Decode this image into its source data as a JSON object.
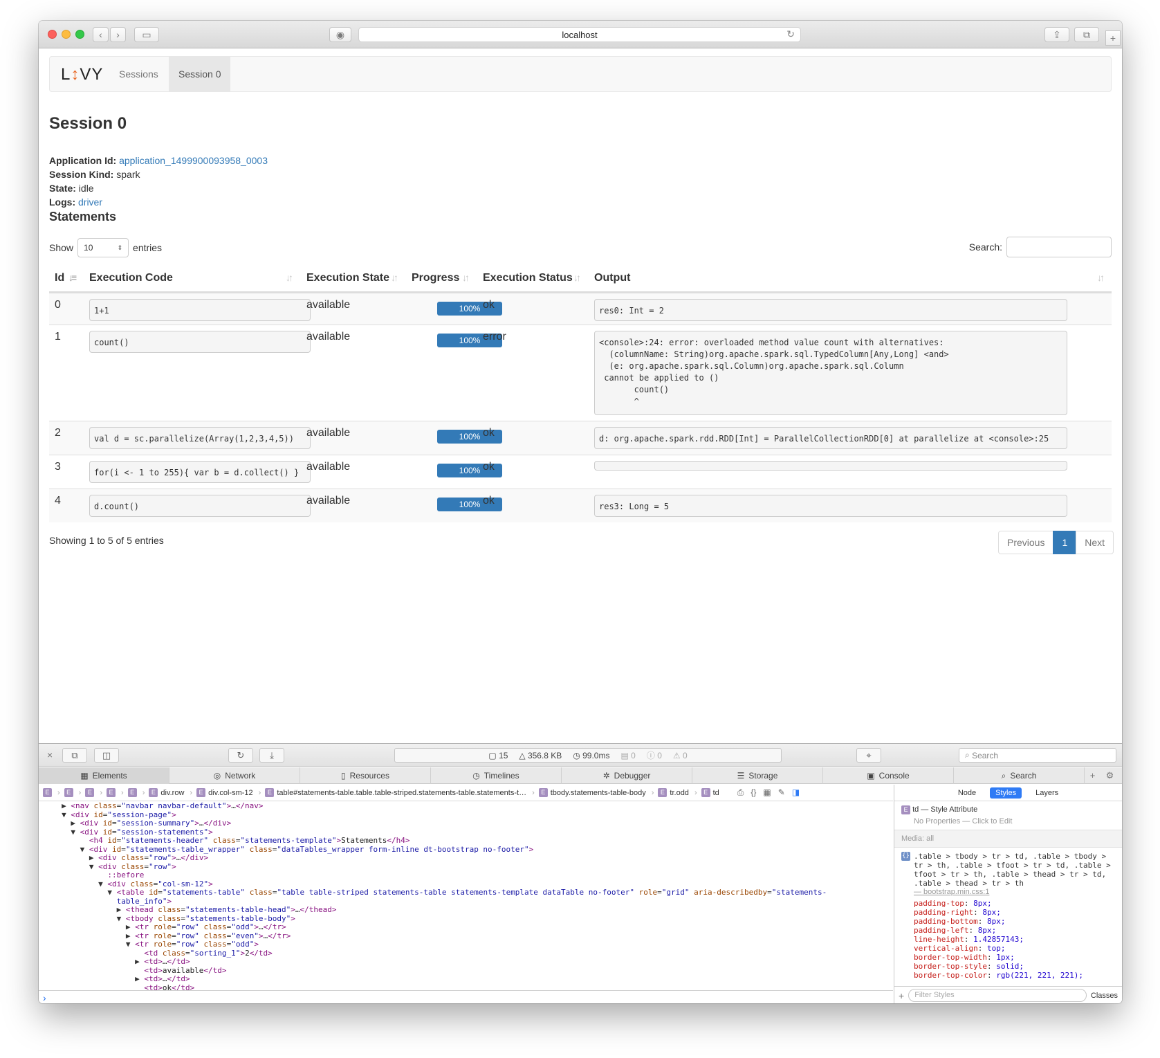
{
  "browser": {
    "url": "localhost"
  },
  "navbar": {
    "brand": "L↕VY",
    "items": [
      {
        "label": "Sessions"
      },
      {
        "label": "Session 0"
      }
    ]
  },
  "session": {
    "title": "Session 0",
    "app_id_label": "Application Id:",
    "app_id": "application_1499900093958_0003",
    "kind_label": "Session Kind:",
    "kind": "spark",
    "state_label": "State:",
    "state": "idle",
    "logs_label": "Logs:",
    "logs": "driver"
  },
  "statements": {
    "header": "Statements",
    "show_label": "Show",
    "page_length": "10",
    "entries_label": "entries",
    "search_label": "Search:",
    "columns": [
      "Id",
      "Execution Code",
      "Execution State",
      "Progress",
      "Execution Status",
      "Output"
    ],
    "rows": [
      {
        "id": "0",
        "code": "1+1",
        "state": "available",
        "progress": "100%",
        "status": "ok",
        "output": "res0: Int = 2"
      },
      {
        "id": "1",
        "code": "count()",
        "state": "available",
        "progress": "100%",
        "status": "error",
        "output": "<console>:24: error: overloaded method value count with alternatives:\n  (columnName: String)org.apache.spark.sql.TypedColumn[Any,Long] <and>\n  (e: org.apache.spark.sql.Column)org.apache.spark.sql.Column\n cannot be applied to ()\n       count()\n       ^"
      },
      {
        "id": "2",
        "code": "val d = sc.parallelize(Array(1,2,3,4,5))",
        "state": "available",
        "progress": "100%",
        "status": "ok",
        "output": "d: org.apache.spark.rdd.RDD[Int] = ParallelCollectionRDD[0] at parallelize at <console>:25"
      },
      {
        "id": "3",
        "code": "for(i <- 1 to 255){ var b = d.collect() }",
        "state": "available",
        "progress": "100%",
        "status": "ok",
        "output": ""
      },
      {
        "id": "4",
        "code": "d.count()",
        "state": "available",
        "progress": "100%",
        "status": "ok",
        "output": "res3: Long = 5"
      }
    ],
    "info": "Showing 1 to 5 of 5 entries",
    "pager": {
      "previous": "Previous",
      "current": "1",
      "next": "Next"
    }
  },
  "inspector": {
    "stats": {
      "resources": "15",
      "size": "356.8 KB",
      "time": "99.0ms",
      "logs": "0",
      "errors": "0",
      "warnings": "0"
    },
    "search_placeholder": "Search",
    "tabs": [
      "Elements",
      "Network",
      "Resources",
      "Timelines",
      "Debugger",
      "Storage",
      "Console",
      "Search"
    ],
    "breadcrumbs": [
      "div.row",
      "div.col-sm-12",
      "table#statements-table.table.table-striped.statements-table.statements-t…",
      "tbody.statements-table-body",
      "tr.odd",
      "td"
    ],
    "side_tabs": [
      "Node",
      "Styles",
      "Layers"
    ],
    "style_attr_title": "td — Style Attribute",
    "style_attr_note": "No Properties — Click to Edit",
    "media_label": "Media: all",
    "rule_selector": ".table > tbody > tr > td, .table > tbody > tr > th, .table > tfoot > tr > td, .table > tfoot > tr > th, .table > thead > tr > td, .table > thead > tr > th",
    "rule_source": "— bootstrap.min.css:1",
    "rule_props": [
      {
        "name": "padding-top",
        "value": "8px;"
      },
      {
        "name": "padding-right",
        "value": "8px;"
      },
      {
        "name": "padding-bottom",
        "value": "8px;"
      },
      {
        "name": "padding-left",
        "value": "8px;"
      },
      {
        "name": "line-height",
        "value": "1.42857143;"
      },
      {
        "name": "vertical-align",
        "value": "top;"
      },
      {
        "name": "border-top-width",
        "value": "1px;"
      },
      {
        "name": "border-top-style",
        "value": "solid;"
      },
      {
        "name": "border-top-color",
        "value": "rgb(221, 221, 221);"
      }
    ],
    "filter_placeholder": "Filter Styles",
    "classes_label": "Classes"
  },
  "colors": {
    "accent": "#337ab7",
    "brand_arrow": "#e8641f"
  }
}
